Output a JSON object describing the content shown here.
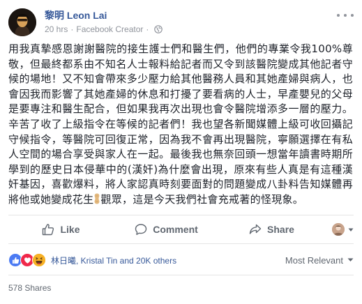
{
  "post": {
    "author": "黎明 Leon Lai",
    "timestamp": "20 hrs",
    "separator": "·",
    "source": "Facebook Creator",
    "text_part1": "用我真摯感恩謝謝醫院的接生護士們和醫生們，他們的專業令我100%尊敬，但最終都系由不知名人士報料給記者而又令到該醫院變成其他記者守候的場地！又不知會帶來多少壓力給其他醫務人員和其她產婦與病人，也會因我而影響了其她產婦的休息和打擾了要看病的人士，早產嬰兒的父母是要專注和醫生配合，但如果我再次出現也會令醫院增添多一層的壓力。辛苦了收了上級指令在等候的記者們！我也望各新聞媒體上級可收回攝記守候指令，等醫院可回復正常，因為我不會再出現醫院，寧願選擇在有私人空間的場合享受與家人在一起。最後我也無奈回頭一想當年讀書時期所學到的歷史日本侵華中的(漢奸)為什麼會出現，原來有些人真是有這種漢奸基因，喜歡爆料，將人家認真時刻要面對的問題變成八卦料告知媒體再將他或她變成花生",
    "text_part2": "觀眾，這是今天我們社會充戒著的怪現象。"
  },
  "actions": {
    "like_label": "Like",
    "comment_label": "Comment",
    "share_label": "Share"
  },
  "reactions": {
    "summary": "林日曦, Kristal Tin and 20K others",
    "types": [
      "like-icon",
      "love-icon",
      "haha-icon"
    ],
    "sort_label": "Most Relevant"
  },
  "shares": {
    "label": "578 Shares"
  },
  "colors": {
    "link_blue": "#365899",
    "text": "#1d2129",
    "secondary": "#90949c",
    "action_gray": "#606770",
    "like_blue": "#4c7bf3",
    "love_red": "#f0284a",
    "haha_yellow": "#f7b125"
  }
}
